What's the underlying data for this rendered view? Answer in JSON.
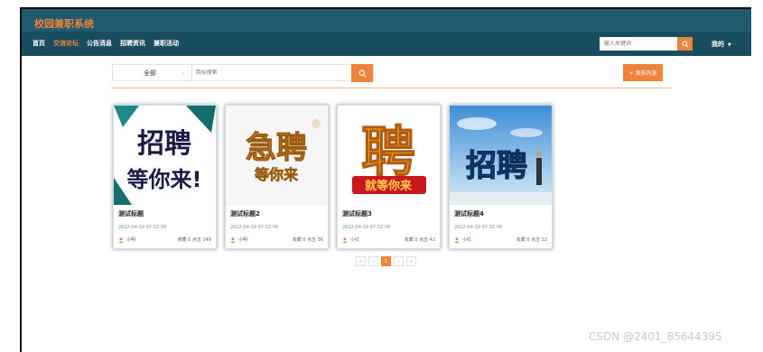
{
  "brand": {
    "title": "校园兼职系统"
  },
  "nav": {
    "items": [
      {
        "label": "首页",
        "active": false
      },
      {
        "label": "交流论坛",
        "active": true
      },
      {
        "label": "公告消息",
        "active": false
      },
      {
        "label": "招聘资讯",
        "active": false
      },
      {
        "label": "兼职活动",
        "active": false
      }
    ],
    "search_placeholder": "输入关键词",
    "user_label": "我的"
  },
  "filter": {
    "category_value": "全部",
    "search_placeholder": "用标搜索",
    "publish_label": "+ 发布内容"
  },
  "cards": [
    {
      "title": "测试标题",
      "date": "2022-04-19 07:32:09",
      "author": "小明",
      "stats": "收藏 0   点击 149"
    },
    {
      "title": "测试标题2",
      "date": "2022-04-19 07:32:09",
      "author": "小明",
      "stats": "收藏 0   点击 36"
    },
    {
      "title": "测试标题3",
      "date": "2022-04-19 07:32:09",
      "author": "小红",
      "stats": "收藏 0   点击 42"
    },
    {
      "title": "测试标题4",
      "date": "2022-04-19 07:32:09",
      "author": "小红",
      "stats": "收藏 0   点击 22"
    }
  ],
  "images": [
    {
      "line1": "招聘",
      "line2": "等你来!"
    },
    {
      "line1": "急聘",
      "line2": "等你来"
    },
    {
      "line1": "聘",
      "line2": "就等你来"
    },
    {
      "line1": "招聘",
      "line2": ""
    }
  ],
  "pagination": {
    "first": "«",
    "prev": "‹",
    "current": "1",
    "next": "›",
    "last": "»"
  },
  "watermark": "CSDN @2401_85644395",
  "colors": {
    "accent": "#f0833a",
    "header": "#1f5a6e",
    "nav": "#174d5e"
  }
}
